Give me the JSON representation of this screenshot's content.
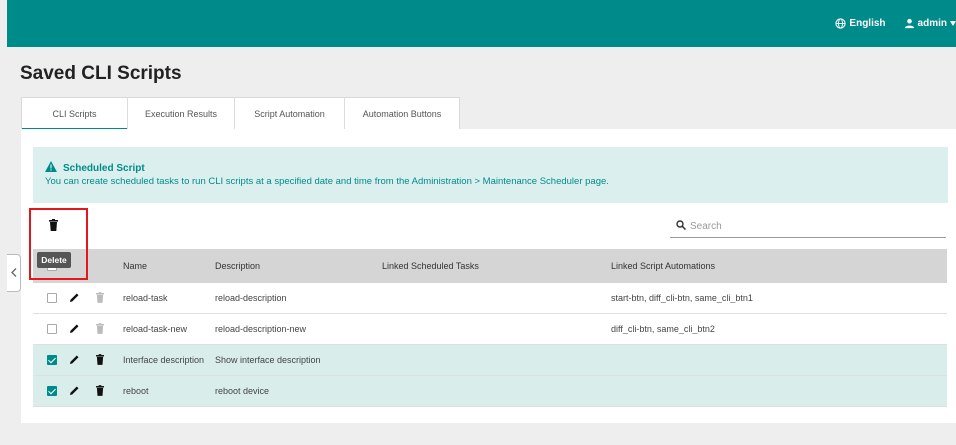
{
  "header": {
    "language": "English",
    "user": "admin"
  },
  "page": {
    "title": "Saved CLI Scripts"
  },
  "tabs": [
    {
      "label": "CLI Scripts",
      "active": true
    },
    {
      "label": "Execution Results",
      "active": false
    },
    {
      "label": "Script Automation",
      "active": false
    },
    {
      "label": "Automation Buttons",
      "active": false
    }
  ],
  "info": {
    "title": "Scheduled Script",
    "text": "You can create scheduled tasks to run CLI scripts at a specified date and time from the Administration > Maintenance Scheduler page."
  },
  "toolbar": {
    "tooltip": "Delete",
    "search_placeholder": "Search"
  },
  "table": {
    "columns": [
      "Name",
      "Description",
      "Linked Scheduled Tasks",
      "Linked Script Automations"
    ],
    "rows": [
      {
        "name": "reload-task",
        "description": "reload-description",
        "linked_tasks": "",
        "linked_automations": "start-btn, diff_cli-btn, same_cli_btn1",
        "checked": false
      },
      {
        "name": "reload-task-new",
        "description": "reload-description-new",
        "linked_tasks": "",
        "linked_automations": "diff_cli-btn, same_cli_btn2",
        "checked": false
      },
      {
        "name": "Interface description",
        "description": "Show interface description",
        "linked_tasks": "",
        "linked_automations": "",
        "checked": true
      },
      {
        "name": "reboot",
        "description": "reboot device",
        "linked_tasks": "",
        "linked_automations": "",
        "checked": true
      }
    ]
  },
  "colors": {
    "brand": "#008b8b",
    "info_bg": "#dbf0ee",
    "highlight": "#e5161c"
  }
}
